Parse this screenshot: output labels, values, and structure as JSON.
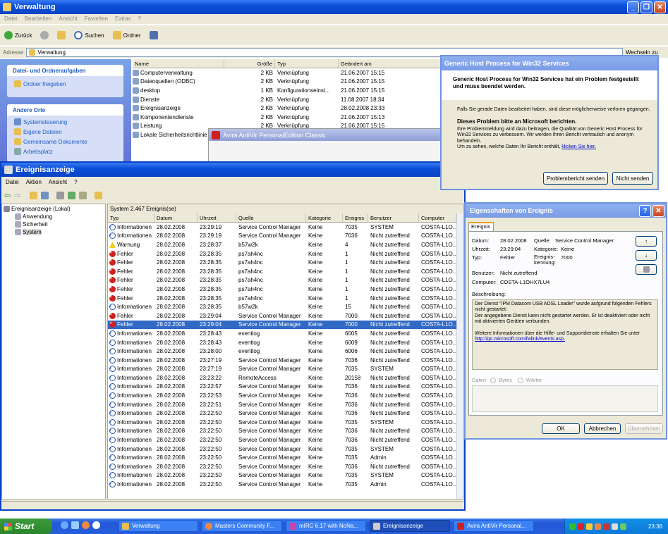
{
  "explorer": {
    "title": "Verwaltung",
    "menu": [
      "Datei",
      "Bearbeiten",
      "Ansicht",
      "Favoriten",
      "Extras",
      "?"
    ],
    "toolbar": {
      "back": "Zurück",
      "search": "Suchen",
      "folders": "Ordner"
    },
    "address_label": "Adresse",
    "address_value": "Verwaltung",
    "go_label": "Wechseln zu",
    "tasks_title": "Datei- und Ordneraufgaben",
    "task_share": "Ordner freigeben",
    "places_title": "Andere Orte",
    "places": [
      "Systemsteuerung",
      "Eigene Dateien",
      "Gemeinsame Dokumente",
      "Arbeitsplatz"
    ],
    "columns": [
      "Name",
      "Größe",
      "Typ",
      "Geändert am"
    ],
    "files": [
      {
        "name": "Computerverwaltung",
        "size": "2 KB",
        "type": "Verknüpfung",
        "date": "21.06.2007 15:15"
      },
      {
        "name": "Datenquellen (ODBC)",
        "size": "2 KB",
        "type": "Verknüpfung",
        "date": "21.06.2007 15:15"
      },
      {
        "name": "desktop",
        "size": "1 KB",
        "type": "Konfigurationseinst...",
        "date": "21.06.2007 15:15"
      },
      {
        "name": "Dienste",
        "size": "2 KB",
        "type": "Verknüpfung",
        "date": "11.08.2007 18:34"
      },
      {
        "name": "Ereignisanzeige",
        "size": "2 KB",
        "type": "Verknüpfung",
        "date": "28.02.2008 23:33"
      },
      {
        "name": "Komponentendienste",
        "size": "2 KB",
        "type": "Verknüpfung",
        "date": "21.06.2007 15:13"
      },
      {
        "name": "Leistung",
        "size": "2 KB",
        "type": "Verknüpfung",
        "date": "21.06.2007 15:15"
      },
      {
        "name": "Lokale Sicherheitsrichtlinie",
        "size": "",
        "type": "",
        "date": ""
      }
    ]
  },
  "avira": {
    "title": "Avira AntiVir PersonalEdition Classic"
  },
  "eventviewer": {
    "title": "Ereignisanzeige",
    "menu": [
      "Datei",
      "Aktion",
      "Ansicht",
      "?"
    ],
    "tree_root": "Ereignisanzeige (Lokal)",
    "tree_items": [
      "Anwendung",
      "Sicherheit",
      "System"
    ],
    "list_caption": "System   2.467 Ereignis(se)",
    "columns": [
      "Typ",
      "Datum",
      "Uhrzeit",
      "Quelle",
      "Kategorie",
      "Ereignis",
      "Benutzer",
      "Computer"
    ],
    "rows": [
      {
        "typ": "Informationen",
        "lvl": "info",
        "datum": "28.02.2008",
        "zeit": "23:29:19",
        "quelle": "Service Control Manager",
        "kat": "Keine",
        "ev": "7035",
        "user": "SYSTEM",
        "comp": "COSTA-L1O..."
      },
      {
        "typ": "Informationen",
        "lvl": "info",
        "datum": "28.02.2008",
        "zeit": "23:29:19",
        "quelle": "Service Control Manager",
        "kat": "Keine",
        "ev": "7036",
        "user": "Nicht zutreffend",
        "comp": "COSTA-L1O..."
      },
      {
        "typ": "Warnung",
        "lvl": "warn",
        "datum": "28.02.2008",
        "zeit": "23:28:37",
        "quelle": "b57w2k",
        "kat": "Keine",
        "ev": "4",
        "user": "Nicht zutreffend",
        "comp": "COSTA-L1O..."
      },
      {
        "typ": "Fehler",
        "lvl": "err",
        "datum": "28.02.2008",
        "zeit": "23:28:35",
        "quelle": "ps7ah4nc",
        "kat": "Keine",
        "ev": "1",
        "user": "Nicht zutreffend",
        "comp": "COSTA-L1O..."
      },
      {
        "typ": "Fehler",
        "lvl": "err",
        "datum": "28.02.2008",
        "zeit": "23:28:35",
        "quelle": "ps7ah4nc",
        "kat": "Keine",
        "ev": "1",
        "user": "Nicht zutreffend",
        "comp": "COSTA-L1O..."
      },
      {
        "typ": "Fehler",
        "lvl": "err",
        "datum": "28.02.2008",
        "zeit": "23:28:35",
        "quelle": "ps7ah4nc",
        "kat": "Keine",
        "ev": "1",
        "user": "Nicht zutreffend",
        "comp": "COSTA-L1O..."
      },
      {
        "typ": "Fehler",
        "lvl": "err",
        "datum": "28.02.2008",
        "zeit": "23:28:35",
        "quelle": "ps7ah4nc",
        "kat": "Keine",
        "ev": "1",
        "user": "Nicht zutreffend",
        "comp": "COSTA-L1O..."
      },
      {
        "typ": "Fehler",
        "lvl": "err",
        "datum": "28.02.2008",
        "zeit": "23:28:35",
        "quelle": "ps7ah4nc",
        "kat": "Keine",
        "ev": "1",
        "user": "Nicht zutreffend",
        "comp": "COSTA-L1O..."
      },
      {
        "typ": "Fehler",
        "lvl": "err",
        "datum": "28.02.2008",
        "zeit": "23:28:35",
        "quelle": "ps7ah4nc",
        "kat": "Keine",
        "ev": "1",
        "user": "Nicht zutreffend",
        "comp": "COSTA-L1O..."
      },
      {
        "typ": "Informationen",
        "lvl": "info",
        "datum": "28.02.2008",
        "zeit": "23:28:35",
        "quelle": "b57w2k",
        "kat": "Keine",
        "ev": "15",
        "user": "Nicht zutreffend",
        "comp": "COSTA-L1O..."
      },
      {
        "typ": "Fehler",
        "lvl": "err",
        "datum": "28.02.2008",
        "zeit": "23:29:04",
        "quelle": "Service Control Manager",
        "kat": "Keine",
        "ev": "7000",
        "user": "Nicht zutreffend",
        "comp": "COSTA-L1O..."
      },
      {
        "typ": "Fehler",
        "lvl": "err",
        "datum": "28.02.2008",
        "zeit": "23:29:04",
        "quelle": "Service Control Manager",
        "kat": "Keine",
        "ev": "7000",
        "user": "Nicht zutreffend",
        "comp": "COSTA-L1O...",
        "selected": true
      },
      {
        "typ": "Informationen",
        "lvl": "info",
        "datum": "28.02.2008",
        "zeit": "23:28:43",
        "quelle": "eventlog",
        "kat": "Keine",
        "ev": "6005",
        "user": "Nicht zutreffend",
        "comp": "COSTA-L1O..."
      },
      {
        "typ": "Informationen",
        "lvl": "info",
        "datum": "28.02.2008",
        "zeit": "23:28:43",
        "quelle": "eventlog",
        "kat": "Keine",
        "ev": "6009",
        "user": "Nicht zutreffend",
        "comp": "COSTA-L1O..."
      },
      {
        "typ": "Informationen",
        "lvl": "info",
        "datum": "28.02.2008",
        "zeit": "23:28:00",
        "quelle": "eventlog",
        "kat": "Keine",
        "ev": "6006",
        "user": "Nicht zutreffend",
        "comp": "COSTA-L1O..."
      },
      {
        "typ": "Informationen",
        "lvl": "info",
        "datum": "28.02.2008",
        "zeit": "23:27:19",
        "quelle": "Service Control Manager",
        "kat": "Keine",
        "ev": "7036",
        "user": "Nicht zutreffend",
        "comp": "COSTA-L1O..."
      },
      {
        "typ": "Informationen",
        "lvl": "info",
        "datum": "28.02.2008",
        "zeit": "23:27:19",
        "quelle": "Service Control Manager",
        "kat": "Keine",
        "ev": "7035",
        "user": "SYSTEM",
        "comp": "COSTA-L1O..."
      },
      {
        "typ": "Informationen",
        "lvl": "info",
        "datum": "28.02.2008",
        "zeit": "23:23:22",
        "quelle": "RemoteAccess",
        "kat": "Keine",
        "ev": "20158",
        "user": "Nicht zutreffend",
        "comp": "COSTA-L1O..."
      },
      {
        "typ": "Informationen",
        "lvl": "info",
        "datum": "28.02.2008",
        "zeit": "23:22:57",
        "quelle": "Service Control Manager",
        "kat": "Keine",
        "ev": "7036",
        "user": "Nicht zutreffend",
        "comp": "COSTA-L1O..."
      },
      {
        "typ": "Informationen",
        "lvl": "info",
        "datum": "28.02.2008",
        "zeit": "23:22:53",
        "quelle": "Service Control Manager",
        "kat": "Keine",
        "ev": "7036",
        "user": "Nicht zutreffend",
        "comp": "COSTA-L1O..."
      },
      {
        "typ": "Informationen",
        "lvl": "info",
        "datum": "28.02.2008",
        "zeit": "23:22:51",
        "quelle": "Service Control Manager",
        "kat": "Keine",
        "ev": "7036",
        "user": "Nicht zutreffend",
        "comp": "COSTA-L1O..."
      },
      {
        "typ": "Informationen",
        "lvl": "info",
        "datum": "28.02.2008",
        "zeit": "23:22:50",
        "quelle": "Service Control Manager",
        "kat": "Keine",
        "ev": "7036",
        "user": "Nicht zutreffend",
        "comp": "COSTA-L1O..."
      },
      {
        "typ": "Informationen",
        "lvl": "info",
        "datum": "28.02.2008",
        "zeit": "23:22:50",
        "quelle": "Service Control Manager",
        "kat": "Keine",
        "ev": "7035",
        "user": "SYSTEM",
        "comp": "COSTA-L1O..."
      },
      {
        "typ": "Informationen",
        "lvl": "info",
        "datum": "28.02.2008",
        "zeit": "23:22:50",
        "quelle": "Service Control Manager",
        "kat": "Keine",
        "ev": "7036",
        "user": "Nicht zutreffend",
        "comp": "COSTA-L1O..."
      },
      {
        "typ": "Informationen",
        "lvl": "info",
        "datum": "28.02.2008",
        "zeit": "23:22:50",
        "quelle": "Service Control Manager",
        "kat": "Keine",
        "ev": "7036",
        "user": "Nicht zutreffend",
        "comp": "COSTA-L1O..."
      },
      {
        "typ": "Informationen",
        "lvl": "info",
        "datum": "28.02.2008",
        "zeit": "23:22:50",
        "quelle": "Service Control Manager",
        "kat": "Keine",
        "ev": "7035",
        "user": "SYSTEM",
        "comp": "COSTA-L1O..."
      },
      {
        "typ": "Informationen",
        "lvl": "info",
        "datum": "28.02.2008",
        "zeit": "23:22:50",
        "quelle": "Service Control Manager",
        "kat": "Keine",
        "ev": "7035",
        "user": "Admin",
        "comp": "COSTA-L1O..."
      },
      {
        "typ": "Informationen",
        "lvl": "info",
        "datum": "28.02.2008",
        "zeit": "23:22:50",
        "quelle": "Service Control Manager",
        "kat": "Keine",
        "ev": "7036",
        "user": "Nicht zutreffend",
        "comp": "COSTA-L1O..."
      },
      {
        "typ": "Informationen",
        "lvl": "info",
        "datum": "28.02.2008",
        "zeit": "23:22:50",
        "quelle": "Service Control Manager",
        "kat": "Keine",
        "ev": "7035",
        "user": "SYSTEM",
        "comp": "COSTA-L1O..."
      },
      {
        "typ": "Informationen",
        "lvl": "info",
        "datum": "28.02.2008",
        "zeit": "23:22:50",
        "quelle": "Service Control Manager",
        "kat": "Keine",
        "ev": "7035",
        "user": "Admin",
        "comp": "COSTA-L1O..."
      }
    ]
  },
  "generic_host": {
    "title": "Generic Host Process for Win32 Services",
    "headline": "Generic Host Process for Win32 Services hat ein Problem festgestellt und muss beendet werden.",
    "save_note": "Falls Sie gerade Daten bearbeitet haben, sind diese möglicherweise verloren gegangen.",
    "report_title": "Dieses Problem bitte an Microsoft berichten.",
    "report_text": "Ihre Problemmeldung wird dazu beitragen, die Qualität von Generic Host Process for Win32 Services zu verbessern. Wir werden Ihren Bericht vertraulich und anonym behandeln.",
    "details_text": "Um zu sehen, welche Daten Ihr Bericht enthält,",
    "details_link": "klicken Sie hier.",
    "send_label": "Problembericht senden",
    "dont_send_label": "Nicht senden"
  },
  "props": {
    "title": "Eigenschaften von Ereignis",
    "tab": "Ereignis",
    "datum_label": "Datum:",
    "datum": "28.02.2008",
    "quelle_label": "Quelle:",
    "quelle": "Service Control Manager",
    "uhrzeit_label": "Uhrzeit:",
    "uhrzeit": "23:29:04",
    "kategorie_label": "Kategorie:",
    "kategorie": "Keine",
    "typ_label": "Typ:",
    "typ": "Fehler",
    "kennung_label": "Ereignis-kennung:",
    "kennung": "7000",
    "benutzer_label": "Benutzer:",
    "benutzer": "Nicht zutreffend",
    "computer_label": "Computer:",
    "computer": "COSTA-L1OHX7LU4",
    "beschreibung_label": "Beschreibung:",
    "beschreibung_1": "Der Dienst \"IPM Datacom USB ADSL Loader\" wurde aufgrund folgenden Fehlers nicht gestartet:",
    "beschreibung_2": "Der angegebene Dienst kann nicht gestartet werden. Er ist deaktiviert oder nicht mit aktivierten Geräten verbunden.",
    "beschreibung_3": "Weitere Informationen über die Hilfe- und Supportdienste erhalten Sie unter",
    "beschreibung_link": "http://go.microsoft.com/fwlink/events.asp.",
    "daten_label": "Daten:",
    "bytes_label": "Bytes",
    "woerter_label": "Wörter",
    "ok": "OK",
    "abbrechen": "Abbrechen",
    "uebernehmen": "Übernehmen"
  },
  "taskbar": {
    "start": "Start",
    "items": [
      "Verwaltung",
      "Masters Community F...",
      "mIRC 6.17 with NoNa...",
      "Ereignisanzeige",
      "Avira AntiVir Personal..."
    ],
    "clock": "23:36"
  }
}
